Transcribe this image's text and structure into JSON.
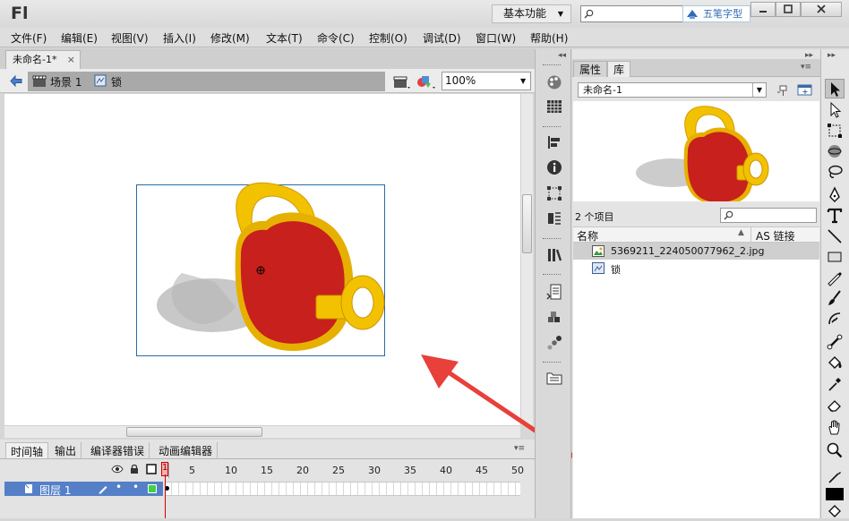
{
  "app": {
    "logo": "Fl",
    "workspace": "基本功能",
    "assistant_label": "五笔字型"
  },
  "menu": [
    "文件(F)",
    "编辑(E)",
    "视图(V)",
    "插入(I)",
    "修改(M)",
    "文本(T)",
    "命令(C)",
    "控制(O)",
    "调试(D)",
    "窗口(W)",
    "帮助(H)"
  ],
  "document": {
    "tab_title": "未命名-1*",
    "close_glyph": "×"
  },
  "editbar": {
    "scene": "场景 1",
    "symbol": "锁",
    "zoom": "100%"
  },
  "timeline": {
    "tabs": [
      "时间轴",
      "输出",
      "编译器错误",
      "动画编辑器"
    ],
    "frame_numbers": [
      "1",
      "5",
      "10",
      "15",
      "20",
      "25",
      "30",
      "35",
      "40",
      "45",
      "50"
    ],
    "layer": {
      "name": "图层 1"
    },
    "current_frame": 1
  },
  "library": {
    "tabs": [
      "属性",
      "库"
    ],
    "active_tab": "库",
    "document_select": "未命名-1",
    "item_count": "2 个项目",
    "columns": {
      "name": "名称",
      "linkage": "AS 链接"
    },
    "items": [
      {
        "name": "5369211_224050077962_2.jpg",
        "icon": "bitmap-icon",
        "selected": true
      },
      {
        "name": "锁",
        "icon": "graphic-symbol-icon",
        "selected": false
      }
    ]
  },
  "colors": {
    "accent_arrow": "#e8403a",
    "layer_highlight": "#5580c8",
    "lock_red": "#c8201c",
    "lock_gold": "#f2c200"
  }
}
